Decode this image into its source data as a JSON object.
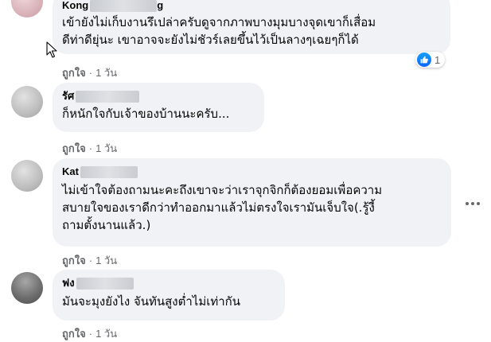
{
  "comments": [
    {
      "author": "Kong",
      "author_suffix": "g",
      "text": "เข้ายังไม่เก็บงานรึเปล่าครับดูจากภาพบางมุมบางจุดเขาก็เสื่อม\nดีท่าดียุ่นะ เขาอาจจะยังไม่ชัวร์เลยขึ้นไว้เป็นลางๆเฉยๆก็ได้",
      "like_label": "ถูกใจ",
      "time": "1 วัน",
      "reaction_count": "1"
    },
    {
      "author": "รัศ",
      "author_suffix": "",
      "text": "ก็หนักใจกับเจ้าของบ้านนะครับ...",
      "like_label": "ถูกใจ",
      "time": "1 วัน"
    },
    {
      "author": "Kat",
      "author_suffix": "",
      "text": "ไม่เข้าใจต้องถามนะคะถึงเขาจะว่าเราจุกจิกก็ต้องยอมเพื่อความ\nสบายใจของเราดีกว่าทำออกมาแล้วไม่ตรงใจเรามันเจ็บใจ(.รู้งี้\nถามตั้งนานแล้ว.)",
      "like_label": "ถูกใจ",
      "time": "1 วัน"
    },
    {
      "author": "ฟง",
      "author_suffix": "",
      "text": "มันจะมุงยังไง จันทันสูงต่ำไม่เท่ากัน",
      "like_label": "ถูกใจ",
      "time": "1 วัน"
    }
  ]
}
